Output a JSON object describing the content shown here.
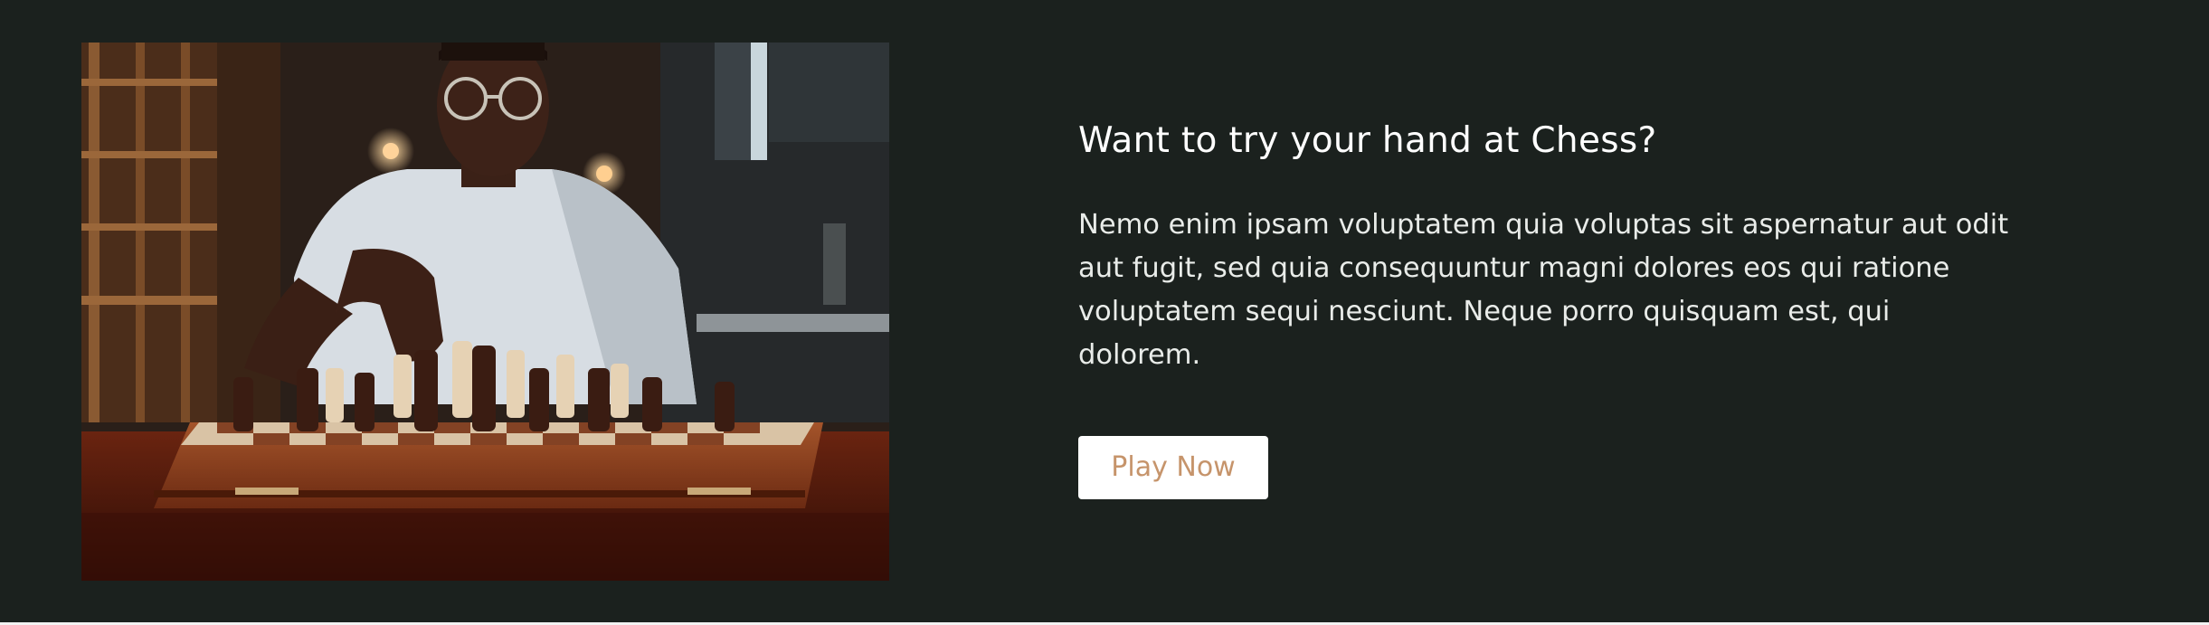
{
  "feature": {
    "image_alt": "Man in glasses moving a chess piece on a wooden chessboard",
    "heading": "Want to try your hand at Chess?",
    "description": "Nemo enim ipsam voluptatem quia voluptas sit aspernatur aut odit aut fugit, sed quia consequuntur magni dolores eos qui ratione voluptatem sequi nesciunt. Neque porro quisquam est, qui dolorem.",
    "cta_label": "Play Now"
  },
  "colors": {
    "background": "#1b211e",
    "heading": "#ffffff",
    "text": "#e9ece9",
    "button_bg": "#ffffff",
    "button_text": "#c6946b"
  }
}
